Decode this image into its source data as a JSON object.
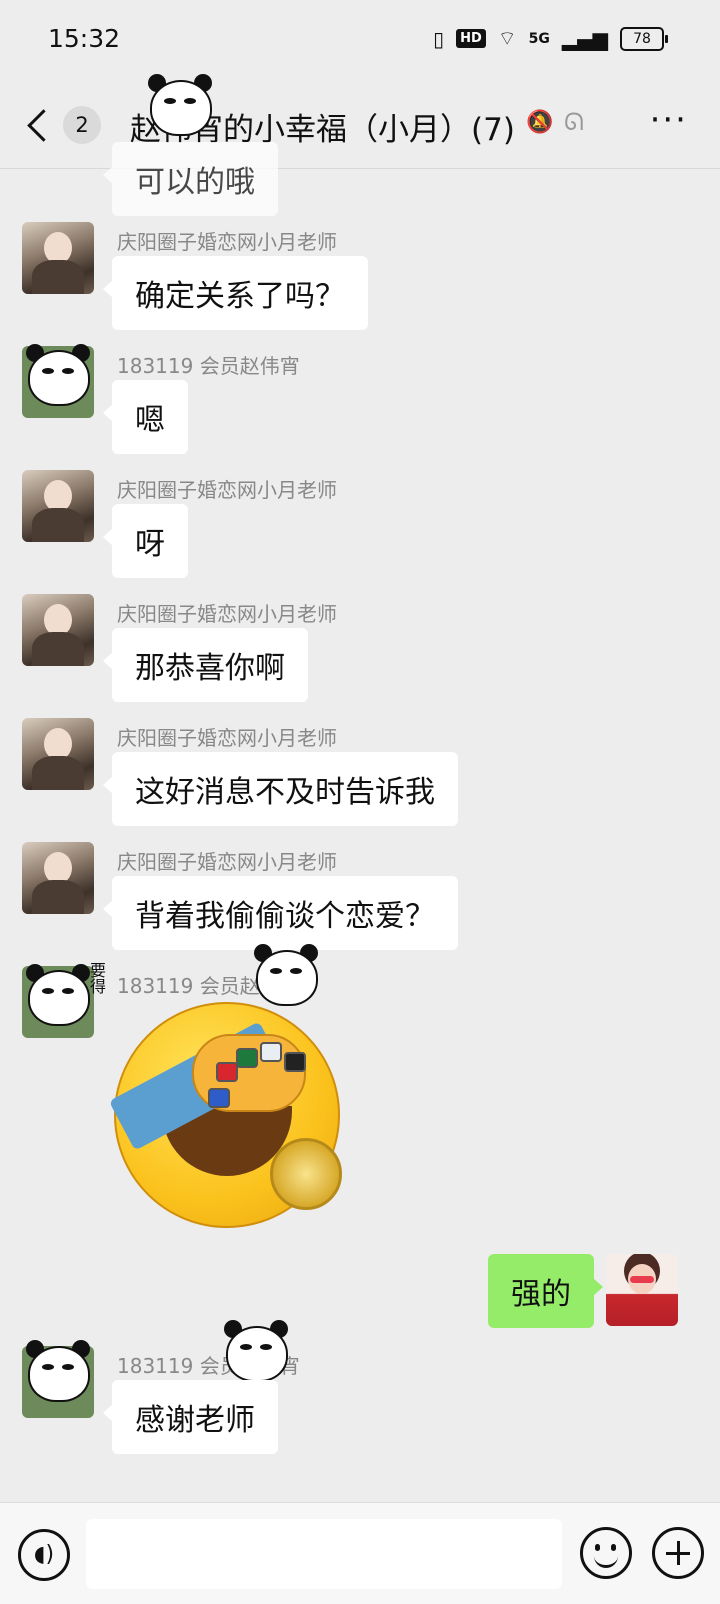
{
  "status_bar": {
    "time": "15:32",
    "hd": "HD",
    "network": "5G",
    "battery": "78"
  },
  "nav": {
    "unread_count": "2",
    "title": "赵伟宵的小幸福（小月）(7)",
    "more": "···"
  },
  "messages": [
    {
      "text": "可以的哦"
    },
    {
      "sender": "庆阳圈子婚恋网小月老师",
      "text": "确定关系了吗？"
    },
    {
      "sender": "183119  会员赵伟宵",
      "text": "嗯"
    },
    {
      "sender": "庆阳圈子婚恋网小月老师",
      "text": "呀"
    },
    {
      "sender": "庆阳圈子婚恋网小月老师",
      "text": "那恭喜你啊"
    },
    {
      "sender": "庆阳圈子婚恋网小月老师",
      "text": "这好消息不及时告诉我"
    },
    {
      "sender": "庆阳圈子婚恋网小月老师",
      "text": "背着我偷偷谈个恋爱？"
    },
    {
      "sender": "183119  会员赵伟宵"
    },
    {
      "text": "强的"
    },
    {
      "sender": "183119  会员赵伟宵",
      "text": "感谢老师"
    }
  ],
  "sticker_text": "要得",
  "input": {
    "placeholder": ""
  }
}
